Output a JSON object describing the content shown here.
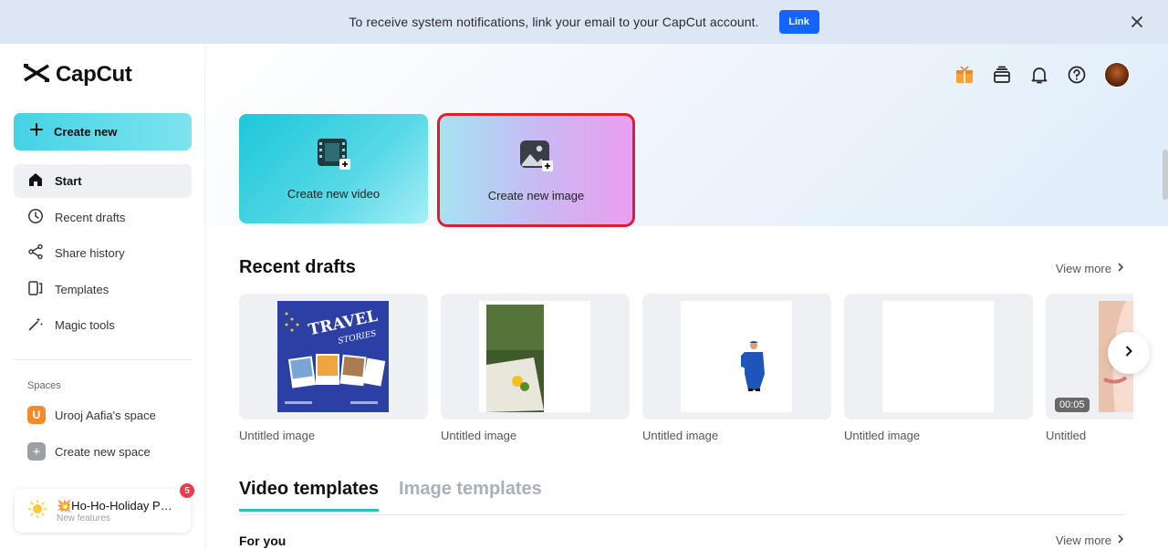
{
  "banner": {
    "text": "To receive system notifications, link your email to your CapCut account.",
    "link_label": "Link",
    "close_icon": "close-icon"
  },
  "sidebar": {
    "logo_text": "CapCut",
    "create_new_label": "Create new",
    "items": [
      {
        "label": "Start",
        "icon": "home-icon",
        "active": true
      },
      {
        "label": "Recent drafts",
        "icon": "clock-icon",
        "active": false
      },
      {
        "label": "Share history",
        "icon": "share-icon",
        "active": false
      },
      {
        "label": "Templates",
        "icon": "templates-icon",
        "active": false
      },
      {
        "label": "Magic tools",
        "icon": "magic-wand-icon",
        "active": false
      }
    ],
    "spaces_label": "Spaces",
    "space_badge": "U",
    "space_name": "Urooj Aafia's space",
    "create_space_label": "Create new space",
    "feature": {
      "title": "💥Ho-Ho-Holiday Party",
      "subtitle": "New features",
      "count": "5"
    }
  },
  "header": {
    "icons": [
      "gift-icon",
      "archive-icon",
      "bell-icon",
      "help-icon",
      "avatar"
    ]
  },
  "create_cards": {
    "video_label": "Create new video",
    "image_label": "Create new image"
  },
  "recent_drafts": {
    "title": "Recent drafts",
    "view_more": "View more",
    "items": [
      {
        "name": "Untitled image"
      },
      {
        "name": "Untitled image"
      },
      {
        "name": "Untitled image"
      },
      {
        "name": "Untitled image"
      },
      {
        "name": "Untitled",
        "duration": "00:05"
      }
    ],
    "poster_text_1": "TRAVEL",
    "poster_text_2": "STORIES"
  },
  "templates": {
    "tabs": [
      {
        "label": "Video templates",
        "active": true
      },
      {
        "label": "Image templates",
        "active": false
      }
    ],
    "for_you": "For you",
    "view_more": "View more"
  },
  "colors": {
    "accent": "#1664ff",
    "teal": "#2fbfbf",
    "highlight_border": "#dc1e2e",
    "badge": "#f2394c"
  }
}
